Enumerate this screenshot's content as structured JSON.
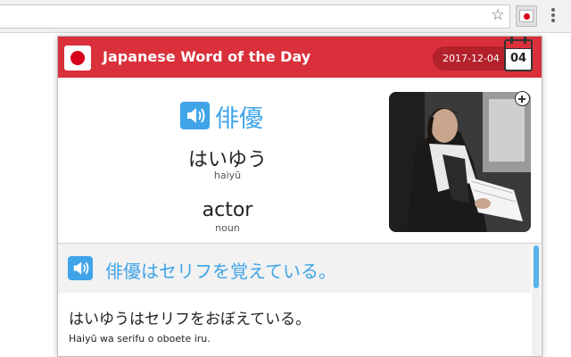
{
  "browser": {
    "star_icon": "star-icon",
    "extension_icon": "japan-flag-icon",
    "menu_icon": "more-vert-icon"
  },
  "popup": {
    "title": "Japanese Word of the Day",
    "date": "2017-12-04",
    "calendar_day": "04",
    "brand_color": "#d9303b",
    "accent_color": "#3fa4e8"
  },
  "word": {
    "kanji": "俳優",
    "kana": "はいゆう",
    "romaji": "haiyū",
    "english": "actor",
    "part_of_speech": "noun"
  },
  "sentence": {
    "japanese": "俳優はセリフを覚えている。",
    "kana": "はいゆうはセリフをおぼえている。",
    "romaji": "Haiyū wa serifu o oboete iru."
  }
}
